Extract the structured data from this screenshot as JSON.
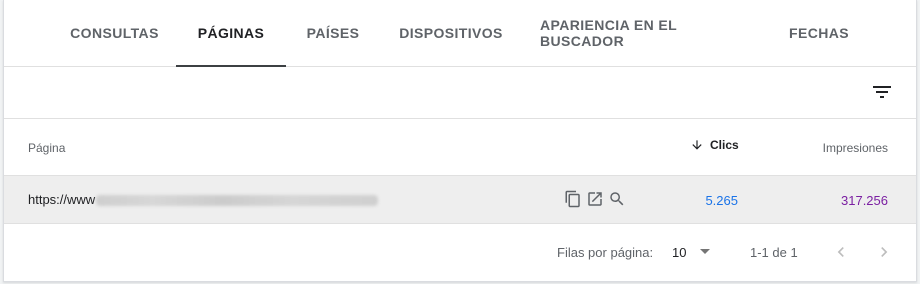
{
  "tabs": [
    {
      "label": "CONSULTAS"
    },
    {
      "label": "PÁGINAS"
    },
    {
      "label": "PAÍSES"
    },
    {
      "label": "DISPOSITIVOS"
    },
    {
      "label": "APARIENCIA EN EL BUSCADOR"
    },
    {
      "label": "FECHAS"
    }
  ],
  "active_tab": "PÁGINAS",
  "table": {
    "columns": {
      "page": "Página",
      "clicks": "Clics",
      "impressions": "Impresiones"
    },
    "sorted_column": "Clics",
    "sort_direction": "descending",
    "rows": [
      {
        "url_prefix": "https://www",
        "clicks": "5.265",
        "impressions": "317.256"
      }
    ]
  },
  "pagination": {
    "rows_per_page_label": "Filas por página:",
    "rows_per_page_value": "10",
    "range": "1-1 de 1"
  },
  "colors": {
    "clicks": "#1a73e8",
    "impressions": "#7b1fa2",
    "active_tab_underline": "#3c4043"
  },
  "icons": [
    "filter-icon",
    "arrow-down-icon",
    "copy-icon",
    "open-in-new-icon",
    "search-icon",
    "chevron-left-icon",
    "chevron-right-icon"
  ]
}
